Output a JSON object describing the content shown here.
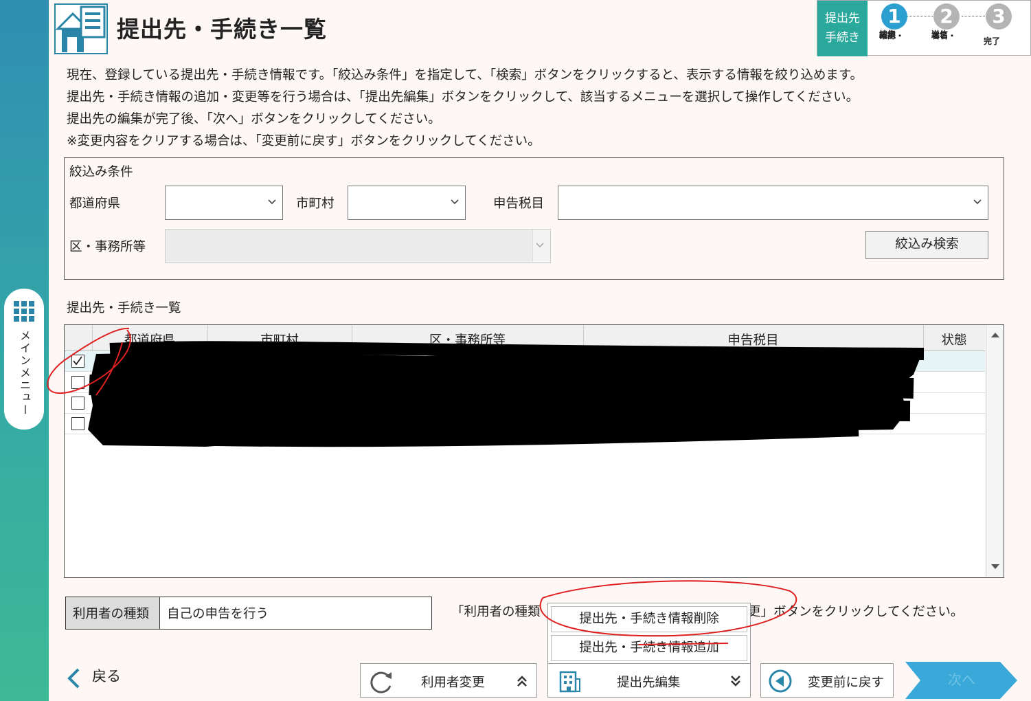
{
  "sidebar": {
    "menu_label": "メインメニュー"
  },
  "header": {
    "title": "提出先・手続き一覧",
    "current_step_label_1": "提出先",
    "current_step_label_2": "手続き",
    "steps": [
      {
        "num": "1",
        "label_1": "確認・",
        "label_2": "編集",
        "color": "#2a9fd0"
      },
      {
        "num": "2",
        "label_1": "署名・",
        "label_2": "送信",
        "color": "#b4b4b4"
      },
      {
        "num": "3",
        "label_1": "完了",
        "label_2": "",
        "color": "#b4b4b4"
      }
    ]
  },
  "intro": [
    "現在、登録している提出先・手続き情報です。「絞込み条件」を指定して、「検索」ボタンをクリックすると、表示する情報を絞り込めます。",
    "提出先・手続き情報の追加・変更等を行う場合は、「提出先編集」ボタンをクリックして、該当するメニューを選択して操作してください。",
    "提出先の編集が完了後、「次へ」ボタンをクリックしてください。",
    "※変更内容をクリアする場合は、「変更前に戻す」ボタンをクリックしてください。"
  ],
  "filter": {
    "title": "絞込み条件",
    "prefecture_label": "都道府県",
    "prefecture_value": "",
    "city_label": "市町村",
    "city_value": "",
    "tax_label": "申告税目",
    "tax_value": "",
    "office_label": "区・事務所等",
    "office_value": "",
    "search_button": "絞込み検索"
  },
  "list": {
    "title": "提出先・手続き一覧",
    "columns": [
      "都道府県",
      "市町村",
      "区・事務所等",
      "申告税目",
      "状態"
    ],
    "rows": [
      {
        "checked": true
      },
      {
        "checked": false
      },
      {
        "checked": false
      },
      {
        "checked": false
      }
    ]
  },
  "user_type": {
    "label": "利用者の種類",
    "value": "自己の申告を行う",
    "hint_prefix": "「利用者の種類",
    "hint_suffix": "更」ボタンをクリックしてください。"
  },
  "popup_menu": {
    "items": [
      "提出先・手続き情報削除",
      "提出先・手続き情報追加"
    ]
  },
  "footer": {
    "back": "戻る",
    "change_user": "利用者変更",
    "edit_destination": "提出先編集",
    "revert": "変更前に戻す",
    "next": "次へ"
  },
  "colors": {
    "accent": "#2aa89c",
    "step_active": "#2a9fd0",
    "next_button": "#3aa8d8",
    "annotation": "#e02020"
  }
}
